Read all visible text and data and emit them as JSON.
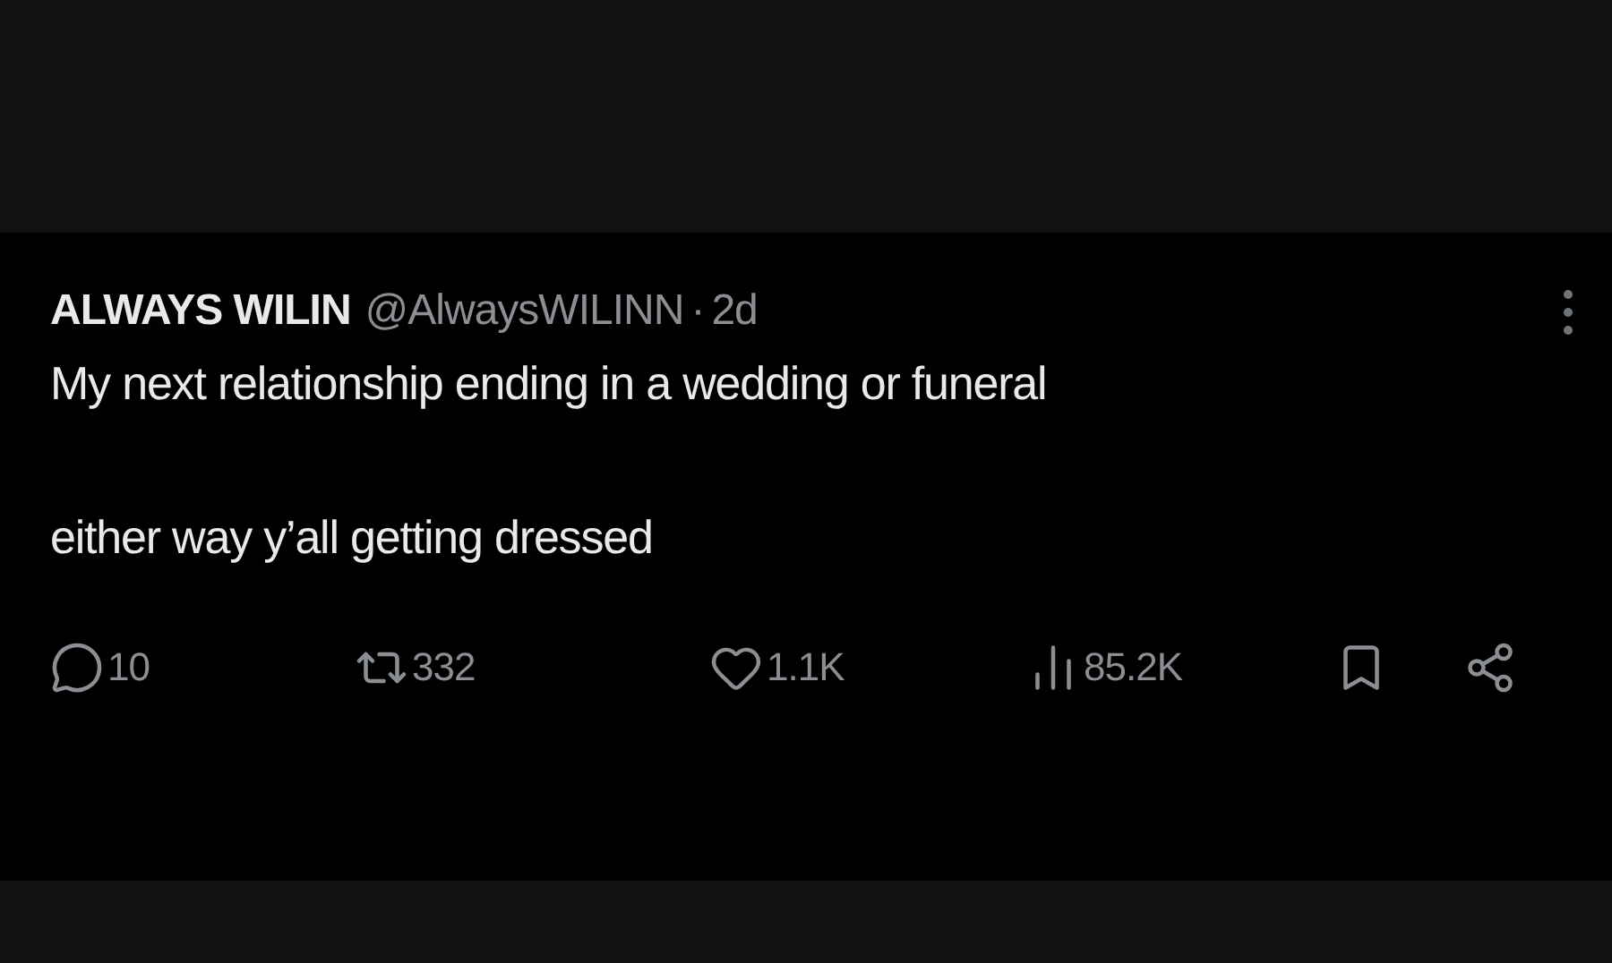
{
  "tweet": {
    "author": {
      "name": "ALWAYS WILIN",
      "handle": "@AlwaysWILINN",
      "separator": "·",
      "time": "2d"
    },
    "paragraphs": [
      "My next relationship ending in a wedding or funeral",
      "either way y’all getting dressed"
    ],
    "actions": [
      {
        "kind": "reply",
        "count": "10"
      },
      {
        "kind": "repost",
        "count": "332"
      },
      {
        "kind": "like",
        "count": "1.1K"
      },
      {
        "kind": "views",
        "count": "85.2K"
      },
      {
        "kind": "bookmark"
      },
      {
        "kind": "share"
      }
    ]
  }
}
